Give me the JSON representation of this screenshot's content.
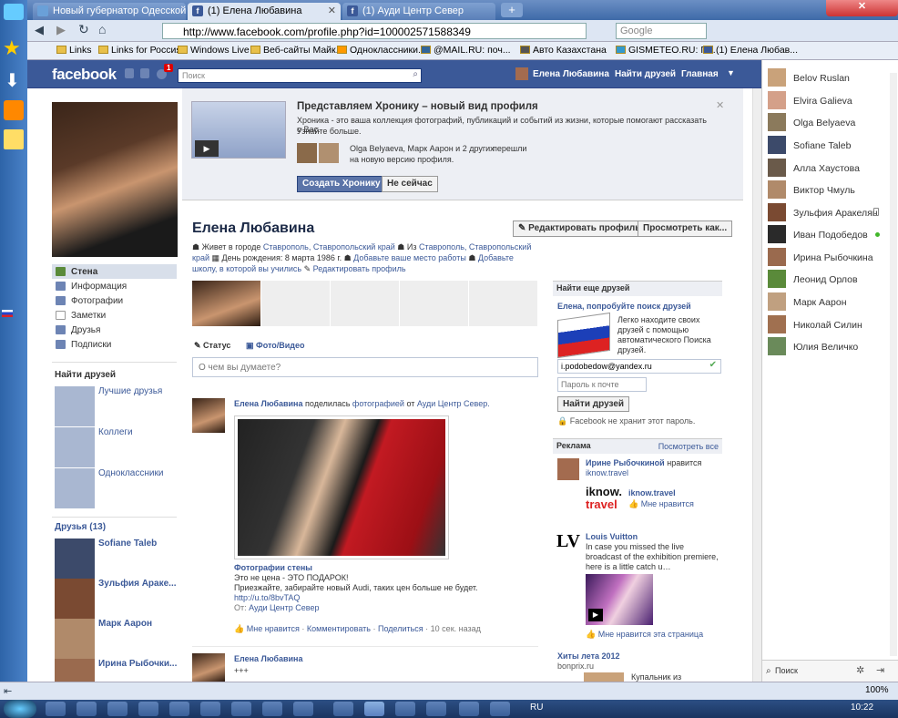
{
  "browser": {
    "tabs": [
      {
        "label": "Новый губернатор Одесской об..."
      },
      {
        "label": "(1) Елена Любавина"
      },
      {
        "label": "(1) Ауди Центр Север"
      }
    ],
    "url": "http://www.facebook.com/profile.php?id=100002571588349",
    "search_placeholder": "Google",
    "bookmarks": [
      "Links",
      "Links for Россия",
      "Windows Live",
      "Веб-сайты Майк...",
      "Одноклассники.ru",
      "@MAIL.RU: поч...",
      "Авто Казахстана",
      "GISMETEO.RU: П...",
      "(1) Елена Любав..."
    ]
  },
  "fb": {
    "logo": "facebook",
    "notif_count": "1",
    "search_placeholder": "Поиск",
    "user_name": "Елена Любавина",
    "nav_find": "Найти друзей",
    "nav_home": "Главная",
    "timeline_promo": {
      "title": "Представляем Хронику – новый вид профиля",
      "desc": "Хроника - это ваша коллекция фотографий, публикаций и событий из жизни, которые помогают рассказать о Вас.",
      "learn_more": "Узнайте больше.",
      "friends_text": "Olga Belyaeva, Марк Аарон и 2 других",
      "friends_suffix": "перешли",
      "friends_line2": "на новую версию профиля.",
      "create_btn": "Создать Хронику",
      "later_btn": "Не сейчас"
    },
    "profile": {
      "name": "Елена Любавина",
      "edit_btn": "Редактировать профиль",
      "view_as_btn": "Просмотреть как...",
      "lives_label": "Живет в городе",
      "lives_city": "Ставрополь, Ставропольский край",
      "from_label": "Из",
      "from_city": "Ставрополь, Ставропольский",
      "from_city2": "край",
      "birthday": "День рождения: 8 марта 1986 г.",
      "add_work": "Добавьте ваше место работы",
      "add_school": "Добавьте",
      "add_school2": "школу, в которой вы учились",
      "edit_profile": "Редактировать профиль"
    },
    "left_nav": [
      "Стена",
      "Информация",
      "Фотографии",
      "Заметки",
      "Друзья",
      "Подписки"
    ],
    "find_friends": {
      "title": "Найти друзей",
      "items": [
        "Лучшие друзья",
        "Коллеги",
        "Одноклассники"
      ]
    },
    "friends": {
      "title": "Друзья (13)",
      "items": [
        "Sofiane Taleb",
        "Зульфия Араке...",
        "Марк Аарон",
        "Ирина Рыбочки..."
      ]
    },
    "composer": {
      "status": "Статус",
      "photo": "Фото/Видео",
      "placeholder": "О чем вы думаете?"
    },
    "post1": {
      "author": "Елена Любавина",
      "action": "поделилась",
      "object": "фотографией",
      "from": "от",
      "page": "Ауди Центр Север.",
      "album": "Фотографии стены",
      "caption1": "Это не цена - ЭТО ПОДАРОК!",
      "caption2": "Приезжайте, забирайте новый Audi, таких цен больше не будет.",
      "link": "http://u.to/8bvTAQ",
      "from_label": "От:",
      "from_page": "Ауди Центр Север",
      "like": "Мне нравится",
      "comment": "Комментировать",
      "share": "Поделиться",
      "time": "10 сек. назад"
    },
    "post2": {
      "author": "Елена Любавина",
      "text": "+++"
    },
    "find_more": {
      "title": "Найти еще друзей",
      "subtitle": "Елена, попробуйте поиск друзей",
      "desc": "Легко находите своих друзей с помощью автоматического Поиска друзей.",
      "email": "i.podobedow@yandex.ru",
      "pass_placeholder": "Пароль к почте",
      "btn": "Найти друзей",
      "note": "Facebook не хранит этот пароль."
    },
    "ads": {
      "title": "Реклама",
      "see_all": "Посмотреть все",
      "ad1_name": "Ирине Рыбочкиной",
      "ad1_likes": "нравится",
      "ad1_site": "iknow.travel",
      "ad1_logo1": "iknow.",
      "ad1_logo2": "travel",
      "ad1_page": "iknow.travel",
      "ad1_like": "Мне нравится",
      "ad2_title": "Louis Vuitton",
      "ad2_text": "In case you missed the live broadcast of the exhibition premiere, here is a little catch u…",
      "ad2_like": "Мне нравится эта страница",
      "ad3_title": "Хиты лета 2012",
      "ad3_site": "bonprix.ru",
      "ad3_text": "Купальник из"
    },
    "chat": {
      "users": [
        "Belov Ruslan",
        "Elvira Galieva",
        "Olga Belyaeva",
        "Sofiane Taleb",
        "Алла Хаустова",
        "Виктор Чмуль",
        "Зульфия Аракелян",
        "Иван Подобедов",
        "Ирина Рыбочкина",
        "Леонид Орлов",
        "Марк Аарон",
        "Николай Силин",
        "Юлия Величко"
      ],
      "search": "Поиск"
    }
  },
  "os": {
    "clock": "10:22",
    "lang": "RU",
    "zoom": "100%"
  }
}
